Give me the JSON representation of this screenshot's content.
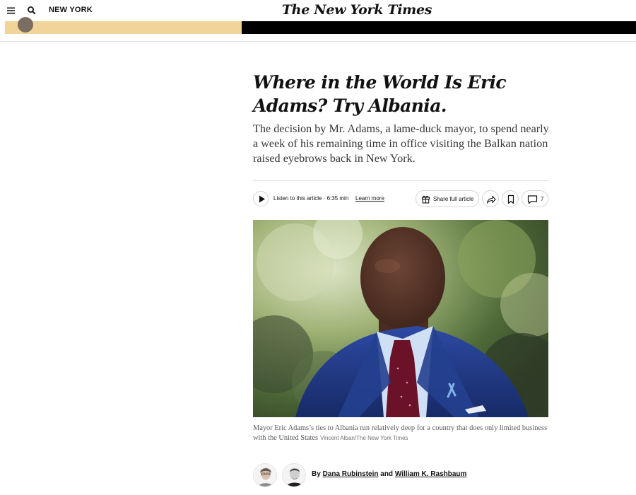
{
  "header": {
    "section": "NEW YORK",
    "masthead": "The New York Times",
    "menu_icon": "hamburger-menu-icon",
    "search_icon": "search-icon"
  },
  "article": {
    "headline": "Where in the World Is Eric Adams? Try Albania.",
    "summary": "The decision by Mr. Adams, a lame-duck mayor, to spend nearly a week of his remaining time in office visiting the Balkan nation raised eyebrows back in New York.",
    "listen": "Listen to this article · 6:35 min",
    "learn_more": "Learn more",
    "share": "Share full article",
    "comments_count": "7",
    "caption": "Mayor Eric Adams’s ties to Albania run relatively deep for a country that does only limited business with the United States",
    "credit": "Vincent Alban/The New York Times",
    "byline": {
      "prefix": "By",
      "author1": "Dana Rubinstein",
      "joiner": "and",
      "author2": "William K. Rashbaum"
    }
  },
  "colors": {
    "banner_left": "#f0d49a",
    "banner_right": "#000000",
    "text": "#121212"
  }
}
